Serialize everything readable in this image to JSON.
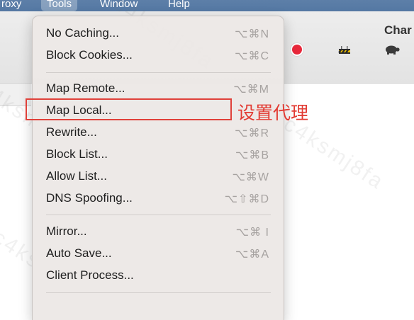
{
  "menubar": {
    "items": [
      "roxy",
      "Tools",
      "Window",
      "Help"
    ],
    "active_item": "Tools"
  },
  "window": {
    "title": "Char"
  },
  "toolbar": {
    "icons": [
      "record-icon",
      "throttle-icon",
      "breakpoint-turtle-icon"
    ],
    "colors": {
      "record": "#e8283b"
    }
  },
  "tools_menu": {
    "items": [
      {
        "label": "No Caching...",
        "shortcut": "⌥⌘N"
      },
      {
        "label": "Block Cookies...",
        "shortcut": "⌥⌘C"
      },
      {
        "label": "Map Remote...",
        "shortcut": "⌥⌘M"
      },
      {
        "label": "Map Local...",
        "shortcut": ""
      },
      {
        "label": "Rewrite...",
        "shortcut": "⌥⌘R"
      },
      {
        "label": "Block List...",
        "shortcut": "⌥⌘B"
      },
      {
        "label": "Allow List...",
        "shortcut": "⌥⌘W"
      },
      {
        "label": "DNS Spoofing...",
        "shortcut": "⌥⇧⌘D"
      },
      {
        "label": "Mirror...",
        "shortcut": "⌥⌘ I"
      },
      {
        "label": "Auto Save...",
        "shortcut": "⌥⌘A"
      },
      {
        "label": "Client Process...",
        "shortcut": ""
      }
    ]
  },
  "annotation": {
    "text": "设置代理",
    "color": "#e23b33"
  },
  "watermark": {
    "text": "c4ksmj8fa"
  }
}
